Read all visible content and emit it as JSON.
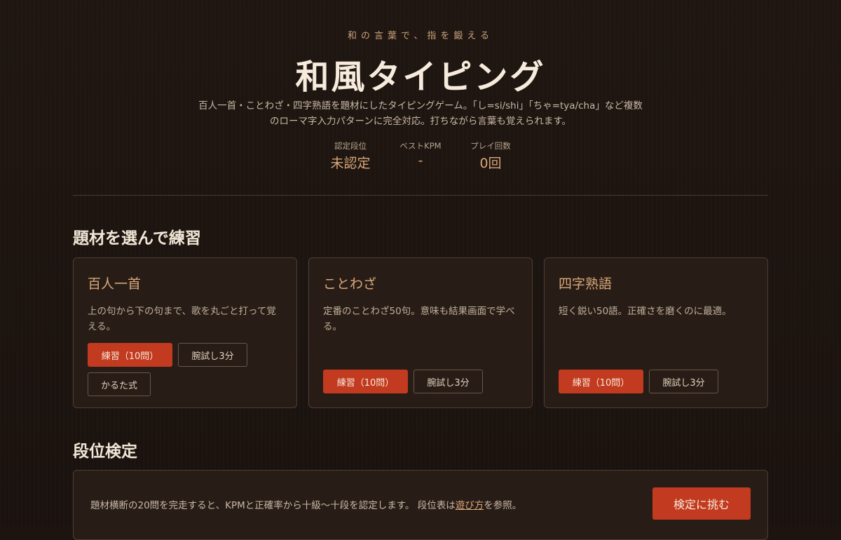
{
  "header": {
    "tagline": "和の言葉で、指を鍛える",
    "title": "和風タイピング",
    "description_line1": "百人一首・ことわざ・四字熟語を題材にしたタイピングゲーム。「し=si/shi」「ちゃ=tya/cha」など複数",
    "description_line2": "のローマ字入力パターンに完全対応。打ちながら言葉も覚えられます。"
  },
  "stats": [
    {
      "label": "認定段位",
      "value": "未認定"
    },
    {
      "label": "ベストKPM",
      "value": "-"
    },
    {
      "label": "プレイ回数",
      "value": "0回"
    }
  ],
  "practice": {
    "heading": "題材を選んで練習",
    "cards": [
      {
        "title": "百人一首",
        "description": "上の句から下の句まで、歌を丸ごと打って覚える。",
        "practice_label": "練習（10問）",
        "trial_label": "腕試し3分",
        "karuta_label": "かるた式"
      },
      {
        "title": "ことわざ",
        "description": "定番のことわざ50句。意味も結果画面で学べる。",
        "practice_label": "練習（10問）",
        "trial_label": "腕試し3分"
      },
      {
        "title": "四字熟語",
        "description": "短く鋭い50語。正確さを磨くのに最適。",
        "practice_label": "練習（10問）",
        "trial_label": "腕試し3分"
      }
    ]
  },
  "exam": {
    "heading": "段位検定",
    "text_before": "題材横断の20問を完走すると、KPMと正確率から十級〜十段を認定します。 段位表は",
    "link_label": "遊び方",
    "text_after": "を参照。",
    "button_label": "検定に挑む"
  },
  "colors": {
    "background": "#1d1410",
    "accent": "#c23a20",
    "gold": "#d9a77a"
  }
}
